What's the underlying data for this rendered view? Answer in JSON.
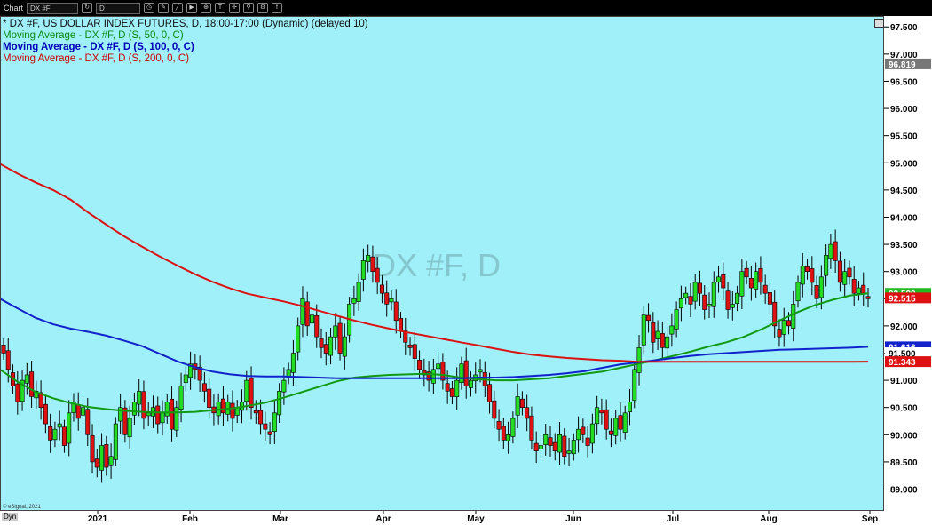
{
  "toolbar": {
    "app_label": "Chart",
    "symbol_value": "DX #F",
    "interval_value": "D"
  },
  "legend": {
    "title": "* DX #F, US DOLLAR INDEX FUTURES, D, 18:00-17:00 (Dynamic) (delayed 10)",
    "ma50": "Moving Average - DX #F, D (S, 50, 0, C)",
    "ma100": "Moving Average - DX #F, D (S, 100, 0, C)",
    "ma200": "Moving Average - DX #F, D (S, 200, 0, C)"
  },
  "watermark": "DX #F, D",
  "footer": {
    "dyn_label": "Dyn",
    "copyright": "© eSignal, 2021"
  },
  "colors": {
    "plot_bg": "#9ff0f8",
    "up": "#22dd22",
    "down": "#dd1111",
    "ma50": "#119911",
    "ma100": "#1122cc",
    "ma200": "#dd1111"
  },
  "chart_data": {
    "type": "candlestick",
    "ylim": [
      88.6,
      97.7
    ],
    "y_ticks": [
      "89.000",
      "89.500",
      "90.000",
      "90.500",
      "91.000",
      "91.500",
      "92.000",
      "92.500",
      "93.000",
      "93.500",
      "94.000",
      "94.500",
      "95.000",
      "95.500",
      "96.000",
      "96.500",
      "97.000",
      "97.500"
    ],
    "x_ticks": [
      "2021",
      "Feb",
      "Mar",
      "Apr",
      "May",
      "Jun",
      "Jul",
      "Aug",
      "Sep"
    ],
    "price_labels": [
      {
        "label": "92.599",
        "value": 92.599,
        "color": "#22bb22"
      },
      {
        "label": "92.515",
        "value": 92.515,
        "color": "#dd1111"
      },
      {
        "label": "91.616",
        "value": 91.616,
        "color": "#1122cc"
      },
      {
        "label": "91.500",
        "value": 91.5,
        "color": "#ffffff"
      },
      {
        "label": "91.343",
        "value": 91.343,
        "color": "#dd1111"
      },
      {
        "label": "96.819",
        "value": 96.819,
        "color": "#777777"
      }
    ],
    "closes": [
      91.5,
      91.2,
      90.9,
      90.6,
      91.0,
      91.1,
      90.7,
      90.8,
      90.5,
      90.2,
      89.9,
      90.1,
      90.2,
      89.8,
      90.4,
      90.6,
      90.3,
      90.5,
      90.0,
      89.5,
      89.4,
      89.8,
      89.4,
      89.6,
      90.2,
      90.5,
      90.0,
      90.3,
      90.6,
      90.8,
      90.3,
      90.4,
      90.5,
      90.2,
      90.4,
      90.6,
      90.1,
      90.5,
      90.9,
      91.1,
      91.3,
      91.2,
      91.0,
      90.8,
      90.5,
      90.4,
      90.6,
      90.4,
      90.6,
      90.3,
      90.5,
      90.6,
      91.0,
      90.5,
      90.4,
      90.2,
      90.1,
      90.0,
      90.4,
      90.8,
      91.0,
      91.2,
      91.5,
      92.0,
      92.5,
      92.0,
      92.2,
      91.8,
      91.6,
      91.5,
      91.8,
      92.0,
      91.5,
      91.8,
      92.4,
      92.5,
      92.8,
      93.2,
      93.3,
      93.0,
      92.8,
      92.6,
      92.4,
      92.5,
      92.1,
      91.9,
      91.7,
      91.6,
      91.4,
      91.2,
      91.1,
      91.0,
      91.2,
      91.3,
      91.0,
      90.8,
      90.7,
      91.0,
      91.3,
      90.9,
      91.0,
      91.1,
      91.2,
      90.9,
      90.6,
      90.3,
      90.1,
      89.9,
      90.0,
      90.3,
      90.7,
      90.5,
      90.3,
      89.9,
      89.7,
      89.8,
      90.0,
      89.8,
      89.7,
      90.0,
      89.6,
      89.7,
      89.9,
      90.1,
      90.0,
      89.8,
      90.2,
      90.5,
      90.4,
      90.1,
      90.0,
      90.3,
      90.1,
      90.4,
      90.6,
      91.2,
      91.6,
      92.2,
      92.1,
      91.7,
      91.9,
      91.6,
      91.8,
      92.0,
      92.3,
      92.5,
      92.6,
      92.4,
      92.8,
      92.6,
      92.3,
      92.4,
      92.8,
      92.9,
      92.7,
      92.3,
      92.4,
      92.6,
      93.0,
      92.9,
      92.7,
      93.0,
      92.8,
      92.6,
      92.4,
      92.0,
      91.8,
      92.1,
      92.0,
      92.4,
      92.8,
      93.1,
      93.0,
      92.8,
      92.5,
      92.9,
      93.3,
      93.5,
      93.2,
      92.8,
      93.0,
      92.9,
      92.6,
      92.7,
      92.6,
      92.5
    ],
    "series": [
      {
        "name": "MA 50",
        "values": [
          91.2,
          90.97,
          90.79,
          90.67,
          90.58,
          90.51,
          90.47,
          90.44,
          90.42,
          90.41,
          90.41,
          90.42,
          90.45,
          90.48,
          90.53,
          90.59,
          90.68,
          90.78,
          90.88,
          90.98,
          91.05,
          91.08,
          91.1,
          91.11,
          91.12,
          91.1,
          91.05,
          91.02,
          91.0,
          91.0,
          91.02,
          91.04,
          91.08,
          91.12,
          91.16,
          91.23,
          91.3,
          91.37,
          91.45,
          91.53,
          91.62,
          91.7,
          91.8,
          91.94,
          92.1,
          92.25,
          92.38,
          92.48,
          92.56,
          92.6
        ]
      },
      {
        "name": "MA 100",
        "values": [
          92.5,
          92.32,
          92.15,
          92.03,
          91.95,
          91.89,
          91.82,
          91.73,
          91.63,
          91.49,
          91.35,
          91.24,
          91.16,
          91.11,
          91.08,
          91.07,
          91.07,
          91.06,
          91.05,
          91.04,
          91.04,
          91.04,
          91.04,
          91.04,
          91.04,
          91.04,
          91.04,
          91.05,
          91.05,
          91.06,
          91.08,
          91.1,
          91.13,
          91.17,
          91.23,
          91.29,
          91.33,
          91.37,
          91.41,
          91.45,
          91.48,
          91.5,
          91.52,
          91.54,
          91.56,
          91.57,
          91.58,
          91.59,
          91.6,
          91.616
        ]
      },
      {
        "name": "MA 200",
        "values": [
          94.98,
          94.8,
          94.64,
          94.5,
          94.32,
          94.08,
          93.86,
          93.65,
          93.46,
          93.28,
          93.11,
          92.95,
          92.81,
          92.69,
          92.59,
          92.52,
          92.45,
          92.37,
          92.28,
          92.19,
          92.1,
          92.02,
          91.95,
          91.88,
          91.82,
          91.76,
          91.7,
          91.64,
          91.58,
          91.52,
          91.47,
          91.44,
          91.41,
          91.39,
          91.37,
          91.36,
          91.34,
          91.34,
          91.34,
          91.34,
          91.34,
          91.34,
          91.34,
          91.34,
          91.34,
          91.34,
          91.34,
          91.34,
          91.34,
          91.343
        ]
      }
    ]
  }
}
